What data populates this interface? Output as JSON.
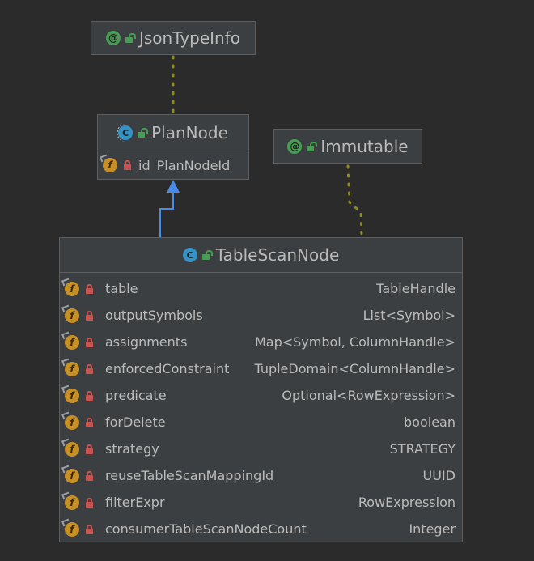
{
  "diagram": {
    "json_type_info": {
      "name": "JsonTypeInfo",
      "kind_icon": "annotation-icon",
      "kind_letter": "@"
    },
    "immutable": {
      "name": "Immutable",
      "kind_icon": "annotation-icon",
      "kind_letter": "@"
    },
    "plan_node": {
      "name": "PlanNode",
      "kind_icon": "abstract-class-icon",
      "kind_letter": "C",
      "fields": [
        {
          "name": "id",
          "type": "PlanNodeId",
          "icon_letter": "f"
        }
      ]
    },
    "table_scan_node": {
      "name": "TableScanNode",
      "kind_icon": "class-icon",
      "kind_letter": "C",
      "fields": [
        {
          "name": "table",
          "type": "TableHandle",
          "icon_letter": "f"
        },
        {
          "name": "outputSymbols",
          "type": "List<Symbol>",
          "icon_letter": "f"
        },
        {
          "name": "assignments",
          "type": "Map<Symbol, ColumnHandle>",
          "icon_letter": "f"
        },
        {
          "name": "enforcedConstraint",
          "type": "TupleDomain<ColumnHandle>",
          "icon_letter": "f"
        },
        {
          "name": "predicate",
          "type": "Optional<RowExpression>",
          "icon_letter": "f"
        },
        {
          "name": "forDelete",
          "type": "boolean",
          "icon_letter": "f"
        },
        {
          "name": "strategy",
          "type": "STRATEGY",
          "icon_letter": "f"
        },
        {
          "name": "reuseTableScanMappingId",
          "type": "UUID",
          "icon_letter": "f"
        },
        {
          "name": "filterExpr",
          "type": "RowExpression",
          "icon_letter": "f"
        },
        {
          "name": "consumerTableScanNodeCount",
          "type": "Integer",
          "icon_letter": "f"
        }
      ]
    },
    "colors": {
      "background": "#2b2b2b",
      "box": "#3c3f41",
      "border": "#5d6063",
      "text": "#bbbbbb",
      "annotation_link": "#8d8d19",
      "inheritance_arrow": "#4a8be8",
      "annotation_icon": "#499c54",
      "class_icon": "#3592c4",
      "field_icon": "#c69026",
      "private_lock": "#c75450"
    }
  }
}
